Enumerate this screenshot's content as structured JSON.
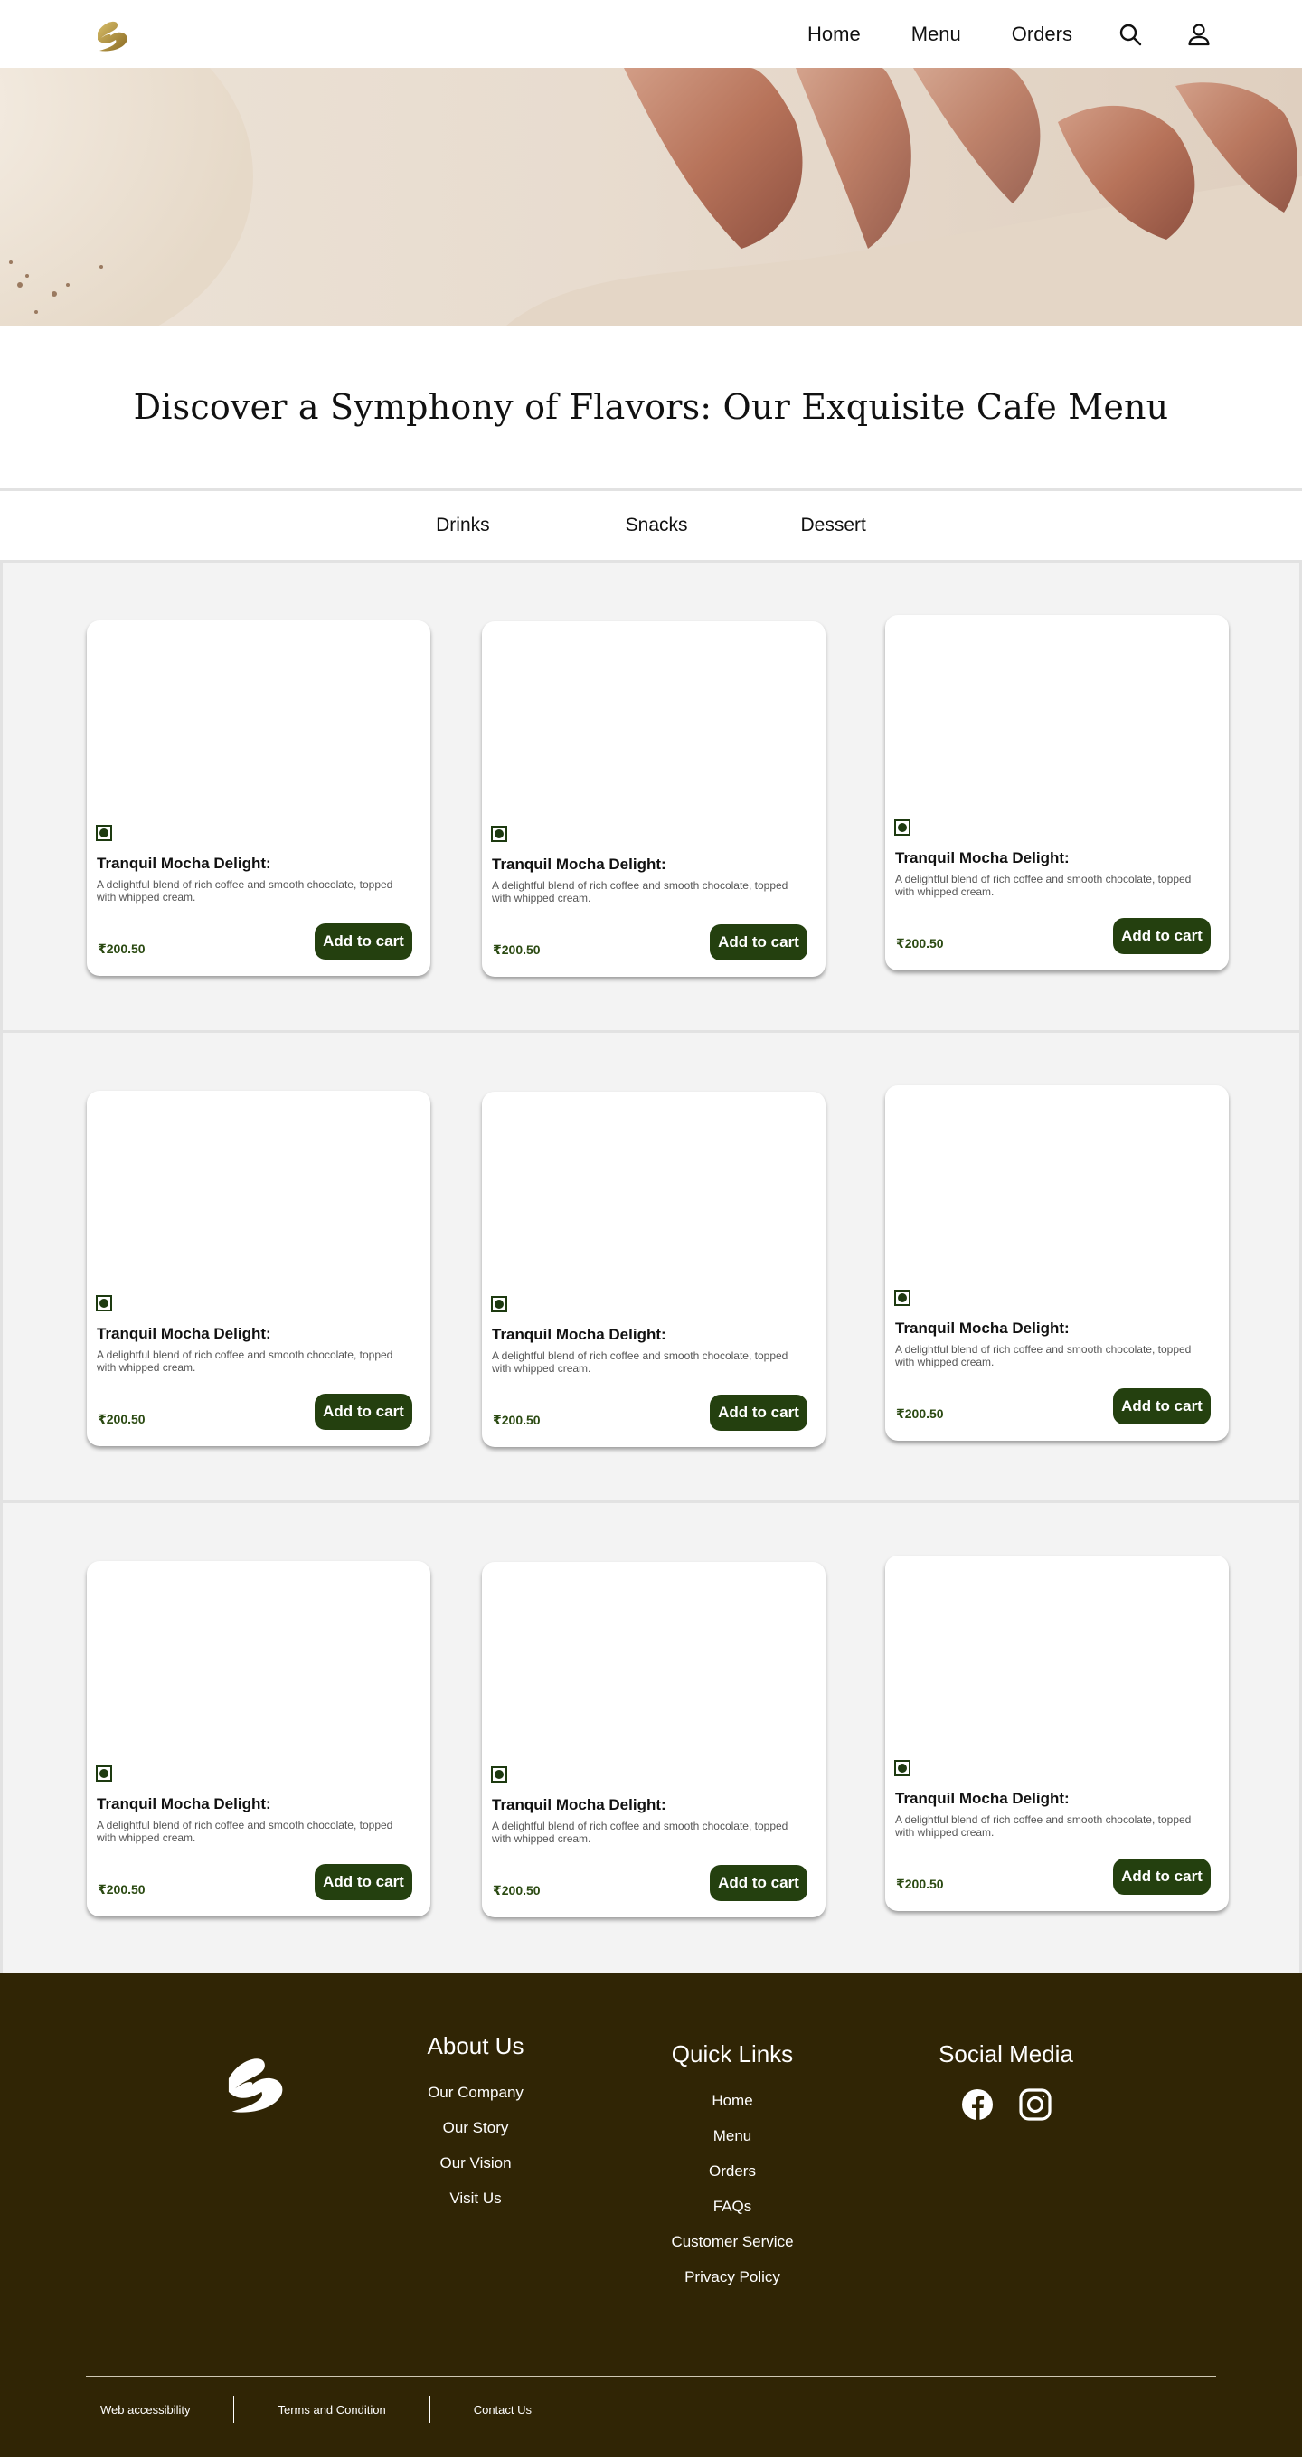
{
  "colors": {
    "accent": "#24400f",
    "price": "#2b4a12",
    "footer_bg": "#302505",
    "logo_gold": "#b08a3a"
  },
  "header": {
    "nav": [
      {
        "label": "Home"
      },
      {
        "label": "Menu"
      },
      {
        "label": "Orders"
      }
    ],
    "icons": [
      "search-icon",
      "user-icon"
    ]
  },
  "main": {
    "title": "Discover a Symphony of Flavors: Our Exquisite Cafe Menu",
    "tabs": [
      {
        "label": "Drinks"
      },
      {
        "label": "Snacks"
      },
      {
        "label": "Dessert"
      }
    ]
  },
  "products": [
    {
      "name": "Tranquil Mocha Delight:",
      "description": "A delightful blend of rich coffee and smooth chocolate, topped with whipped cream.",
      "price": "₹200.50",
      "button": "Add to cart"
    },
    {
      "name": "Tranquil Mocha Delight:",
      "description": "A delightful blend of rich coffee and smooth chocolate, topped with whipped cream.",
      "price": "₹200.50",
      "button": "Add to cart"
    },
    {
      "name": "Tranquil Mocha Delight:",
      "description": "A delightful blend of rich coffee and smooth chocolate, topped with whipped cream.",
      "price": "₹200.50",
      "button": "Add to cart"
    },
    {
      "name": "Tranquil Mocha Delight:",
      "description": "A delightful blend of rich coffee and smooth chocolate, topped with whipped cream.",
      "price": "₹200.50",
      "button": "Add to cart"
    },
    {
      "name": "Tranquil Mocha Delight:",
      "description": "A delightful blend of rich coffee and smooth chocolate, topped with whipped cream.",
      "price": "₹200.50",
      "button": "Add to cart"
    },
    {
      "name": "Tranquil Mocha Delight:",
      "description": "A delightful blend of rich coffee and smooth chocolate, topped with whipped cream.",
      "price": "₹200.50",
      "button": "Add to cart"
    },
    {
      "name": "Tranquil Mocha Delight:",
      "description": "A delightful blend of rich coffee and smooth chocolate, topped with whipped cream.",
      "price": "₹200.50",
      "button": "Add to cart"
    },
    {
      "name": "Tranquil Mocha Delight:",
      "description": "A delightful blend of rich coffee and smooth chocolate, topped with whipped cream.",
      "price": "₹200.50",
      "button": "Add to cart"
    },
    {
      "name": "Tranquil Mocha Delight:",
      "description": "A delightful blend of rich coffee and smooth chocolate, topped with whipped cream.",
      "price": "₹200.50",
      "button": "Add to cart"
    }
  ],
  "footer": {
    "about": {
      "heading": "About Us",
      "links": [
        "Our Company",
        "Our Story",
        "Our Vision",
        "Visit Us"
      ]
    },
    "quick_links": {
      "heading": "Quick Links",
      "links": [
        "Home",
        "Menu",
        "Orders",
        "FAQs",
        "Customer Service",
        "Privacy Policy"
      ]
    },
    "social": {
      "heading": "Social Media",
      "icons": [
        "facebook-icon",
        "instagram-icon"
      ]
    },
    "bottom_links": [
      "Web accessibility",
      "Terms and Condition",
      "Contact Us"
    ]
  }
}
